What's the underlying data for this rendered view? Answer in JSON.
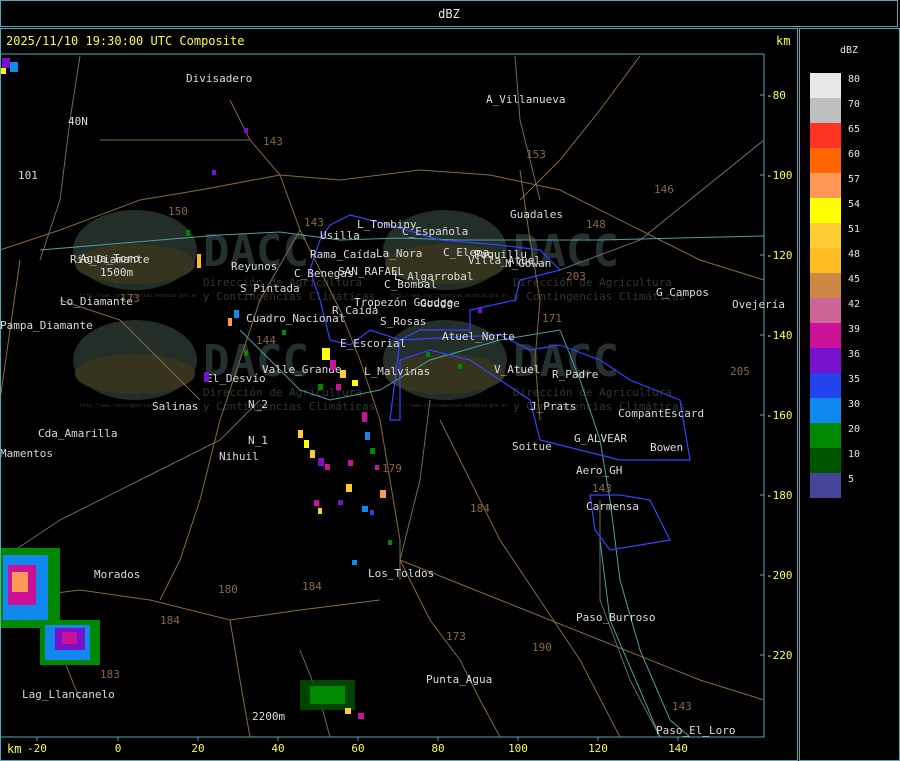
{
  "title": "dBZ",
  "header": {
    "datetime": "2025/11/10 19:30:00 UTC Composite",
    "unit_top": "km",
    "unit_bottom": "km"
  },
  "axes": {
    "x_ticks": [
      "-20",
      "0",
      "20",
      "40",
      "60",
      "80",
      "100",
      "120",
      "140"
    ],
    "y_ticks": [
      "-80",
      "-100",
      "-120",
      "-140",
      "-160",
      "-180",
      "-200",
      "-220"
    ]
  },
  "colors": {
    "frame": "#5aa6b4",
    "text": "#ffff33",
    "roads": "#8a6a3a",
    "rivers": "#4aa0a0",
    "boundaries": "#3344ff",
    "places": "#dcdcdc"
  },
  "legend": {
    "title": "dBZ",
    "items": [
      {
        "label": "80",
        "color": "#e8e8e8"
      },
      {
        "label": "70",
        "color": "#bfbfbf"
      },
      {
        "label": "65",
        "color": "#ff3322"
      },
      {
        "label": "60",
        "color": "#ff6600"
      },
      {
        "label": "57",
        "color": "#ff9955"
      },
      {
        "label": "54",
        "color": "#ffff00"
      },
      {
        "label": "51",
        "color": "#ffcc33"
      },
      {
        "label": "48",
        "color": "#ffbb22"
      },
      {
        "label": "45",
        "color": "#cc8844"
      },
      {
        "label": "42",
        "color": "#cc6699"
      },
      {
        "label": "39",
        "color": "#cc1199"
      },
      {
        "label": "36",
        "color": "#7711cc"
      },
      {
        "label": "35",
        "color": "#2244ee"
      },
      {
        "label": "30",
        "color": "#1188ee"
      },
      {
        "label": "20",
        "color": "#008800"
      },
      {
        "label": "10",
        "color": "#005500"
      },
      {
        "label": "5",
        "color": "#444499"
      }
    ]
  },
  "watermark": {
    "name": "DACC",
    "line1": "Dirección de Agricultura",
    "line2": "y Contingencias Climáticas",
    "url": "http://www.contingencias.mendoza.gov.ar"
  },
  "places": [
    "Divisadero",
    "A_Villanueva",
    "40N",
    "101",
    "Guadales",
    "Usilla",
    "L_Tombiny",
    "C_Española",
    "C_Elepa",
    "La_Nora",
    "Paquillu",
    "Rama_Caída",
    "Rio_Diamante",
    "Villa_Atuel",
    "N_Gowan",
    "Goudge",
    "Reyunos",
    "Lo_Diamante",
    "S_Pintada",
    "C_Benegas",
    "SAN_RAFAEL",
    "L_Algarrobal",
    "C_Bombal",
    "G_Campos",
    "Ovejería",
    "Cuadro_Nacional",
    "R_Caída",
    "S_Rosas",
    "Tropezón Goudge",
    "Atuel_Norte",
    "Pampa_Diamante",
    "E_Escorial",
    "Valle_Grande",
    "L_Malvinas",
    "V_Atuel",
    "R_Padre",
    "El_Desvío",
    "Salinas",
    "N_2",
    "J_Prats",
    "CompantEscard",
    "Cda_Amarilla",
    "N_1",
    "Nihuil",
    "G_ALVEAR",
    "Bowen",
    "Soitue",
    "Aero_GH",
    "Carmensa",
    "Morados",
    "Los_Toldos",
    "Paso_Burroso",
    "Punta_Agua",
    "Lag_Llancanelo",
    "Paso_El_Loro",
    "Agua_Toro",
    "1500m",
    "2200m",
    "Mamentos"
  ],
  "road_numbers": [
    "143",
    "153",
    "146",
    "150",
    "143",
    "148",
    "203",
    "171",
    "144",
    "173",
    "184",
    "180",
    "184",
    "179",
    "190",
    "143",
    "183",
    "184",
    "205",
    "143",
    "173"
  ]
}
